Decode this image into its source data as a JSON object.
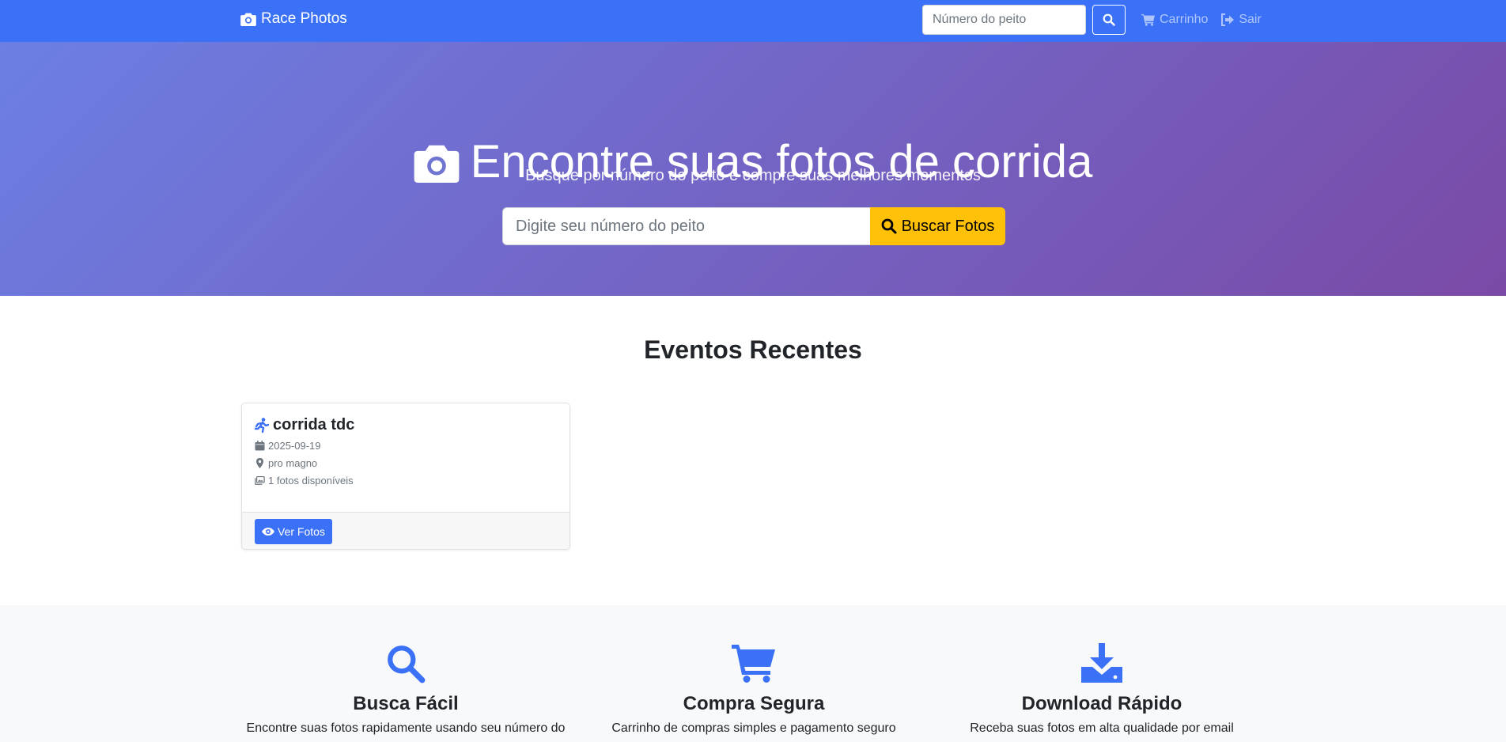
{
  "navbar": {
    "brand": "Race Photos",
    "search_placeholder": "Número do peito",
    "cart_label": "Carrinho",
    "exit_label": "Sair"
  },
  "hero": {
    "title": "Encontre suas fotos de corrida",
    "subtitle": "Busque por número do peito e compre suas melhores momentos",
    "search_placeholder": "Digite seu número do peito",
    "search_button": "Buscar Fotos"
  },
  "events": {
    "heading": "Eventos Recentes",
    "items": [
      {
        "name": "corrida tdc",
        "date": "2025-09-19",
        "location": "pro magno",
        "photos": "1 fotos disponíveis",
        "button": "Ver Fotos"
      }
    ]
  },
  "features": [
    {
      "icon": "search-icon",
      "title": "Busca Fácil",
      "text": "Encontre suas fotos rapidamente usando seu número do"
    },
    {
      "icon": "cart-icon",
      "title": "Compra Segura",
      "text": "Carrinho de compras simples e pagamento seguro"
    },
    {
      "icon": "download-icon",
      "title": "Download Rápido",
      "text": "Receba suas fotos em alta qualidade por email"
    }
  ],
  "colors": {
    "primary": "#3b71f6",
    "accent": "#ffc107",
    "hero_gradient_start": "#6c7fe3",
    "hero_gradient_end": "#7a4aa6"
  }
}
